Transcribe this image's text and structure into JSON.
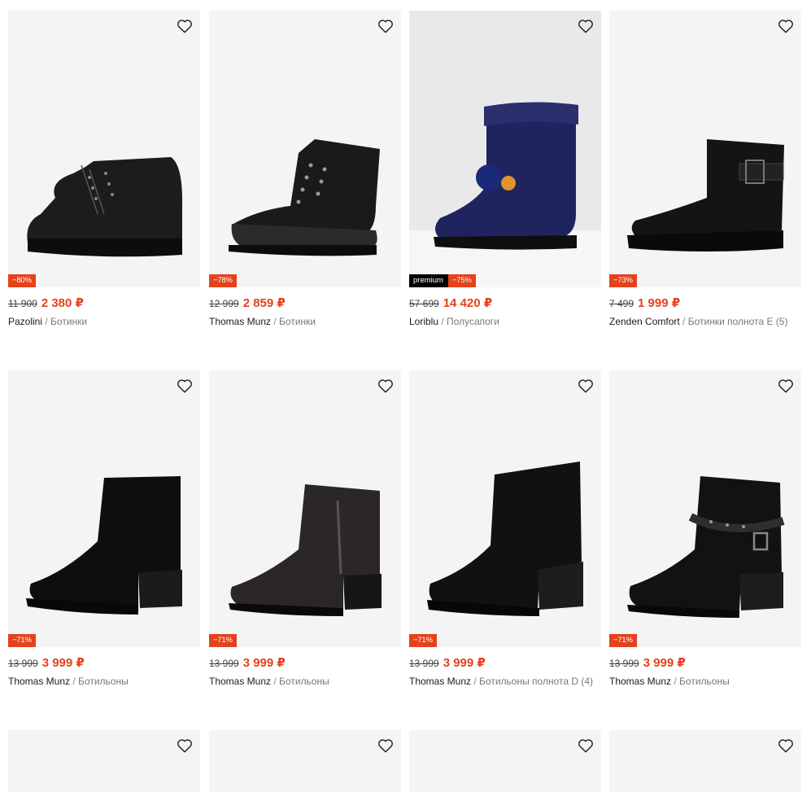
{
  "currency": "₽",
  "products": [
    {
      "old_price": "11 900",
      "price": "2 380 ₽",
      "discount": "−80%",
      "brand": "Pazolini",
      "category": "Ботинки",
      "premium": ""
    },
    {
      "old_price": "12 999",
      "price": "2 859 ₽",
      "discount": "−78%",
      "brand": "Thomas Munz",
      "category": "Ботинки",
      "premium": ""
    },
    {
      "old_price": "57 699",
      "price": "14 420 ₽",
      "discount": "−75%",
      "brand": "Loriblu",
      "category": "Полусапоги",
      "premium": "premium"
    },
    {
      "old_price": "7 499",
      "price": "1 999 ₽",
      "discount": "−73%",
      "brand": "Zenden Comfort",
      "category": "Ботинки полнота E (5)",
      "premium": ""
    },
    {
      "old_price": "13 999",
      "price": "3 999 ₽",
      "discount": "−71%",
      "brand": "Thomas Munz",
      "category": "Ботильоны",
      "premium": ""
    },
    {
      "old_price": "13 999",
      "price": "3 999 ₽",
      "discount": "−71%",
      "brand": "Thomas Munz",
      "category": "Ботильоны",
      "premium": ""
    },
    {
      "old_price": "13 999",
      "price": "3 999 ₽",
      "discount": "−71%",
      "brand": "Thomas Munz",
      "category": "Ботильоны полнота D (4)",
      "premium": ""
    },
    {
      "old_price": "13 999",
      "price": "3 999 ₽",
      "discount": "−71%",
      "brand": "Thomas Munz",
      "category": "Ботильоны",
      "premium": ""
    }
  ],
  "icons": {
    "favorite": "heart-icon"
  },
  "colors": {
    "accent": "#e4421c",
    "premium_bg": "#000000",
    "card_bg": "#f4f4f4"
  }
}
